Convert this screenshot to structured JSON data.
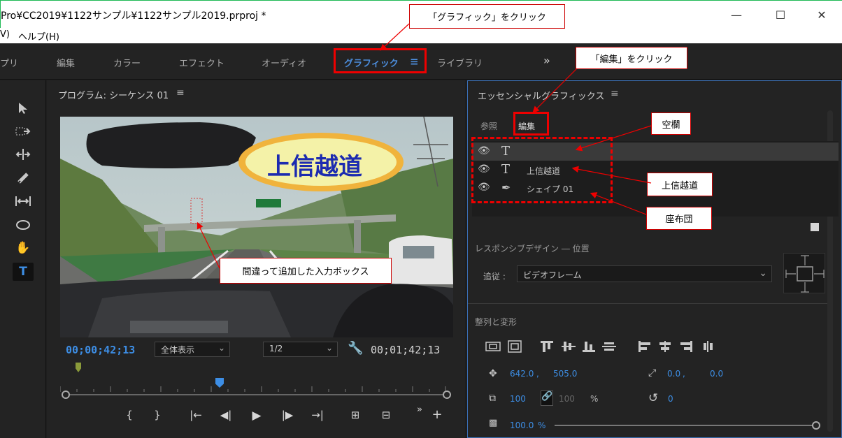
{
  "window": {
    "title": "Pro¥CC2019¥1122サンプル¥1122サンプル2019.prproj *",
    "minimize": "—",
    "maximize": "☐",
    "close": "✕"
  },
  "menu": {
    "view_fragment": "V)",
    "help": "ヘルプ(H)"
  },
  "workspaces": {
    "tabs": [
      "プリ",
      "編集",
      "カラー",
      "エフェクト",
      "オーディオ",
      "グラフィック",
      "ライブラリ"
    ],
    "active": "グラフィック",
    "more": "»"
  },
  "callouts": {
    "graphics_click": "「グラフィック」をクリック",
    "edit_click": "「編集」をクリック",
    "empty": "空欄",
    "kamishinetsu": "上信越道",
    "zabuton": "座布団",
    "wrong_box": "間違って追加した入力ボックス"
  },
  "program": {
    "title": "プログラム: シーケンス 01",
    "menu_icon": "≡",
    "video_title_text": "上信越道",
    "current_timecode": "00;00;42;13",
    "zoom": "全体表示",
    "resolution": "1/2",
    "duration_timecode": "00;01;42;13",
    "controls": [
      "{",
      "}",
      "|←",
      "◀|",
      "▶",
      "|▶",
      "→|",
      "⊞",
      "⊟",
      "»",
      "+"
    ]
  },
  "essential_graphics": {
    "title": "エッセンシャルグラフィックス",
    "menu_icon": "≡",
    "tabs": {
      "browse": "参照",
      "edit": "編集"
    },
    "layers": [
      {
        "type": "T",
        "name": ""
      },
      {
        "type": "T",
        "name": "上信越道"
      },
      {
        "type": "✒",
        "name": "シェイプ 01"
      }
    ],
    "responsive_title": "レスポンシブデザイン ― 位置",
    "follow_label": "追従 :",
    "follow_value": "ビデオフレーム",
    "align_title": "整列と変形",
    "position": {
      "x": "642.0",
      "y": "505.0"
    },
    "anchor": {
      "x": "0.0",
      "y": "0.0"
    },
    "scale": "100",
    "scale_h": "100",
    "scale_unit": "%",
    "rotation": "0",
    "opacity": "100.0",
    "opacity_unit": "%"
  }
}
